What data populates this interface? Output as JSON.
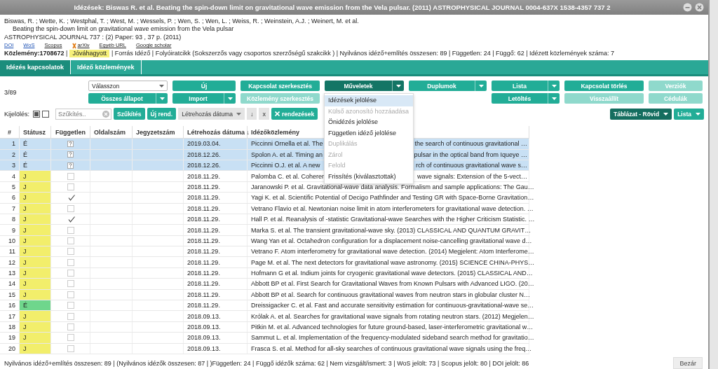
{
  "window": {
    "title": "Idézések: Biswas R. et al. Beating the spin-down limit on gravitational wave emission from the Vela pulsar. (2011) ASTROPHYSICAL JOURNAL 0004-637X 1538-4357 737 2"
  },
  "publication": {
    "authors": "Biswas, R. ; Wette, K. ; Westphal, T. ; West, M. ; Wessels, P. ; Wen, S. ; Wen, L. ; Weiss, R. ; Weinstein, A.J. ; Weinert, M. et al.",
    "title": "Beating the spin-down limit on gravitational wave emission from the Vela pulsar",
    "journal": "ASTROPHYSICAL JOURNAL 737 : (2) Paper: 93 , 37 p. (2011)",
    "links": [
      {
        "label": "DOI",
        "kind": "plain"
      },
      {
        "label": "WoS",
        "kind": "plain"
      },
      {
        "label": "Scopus",
        "kind": "plain"
      },
      {
        "label": "arXiv",
        "kind": "arxiv"
      },
      {
        "label": "Egyéb URL",
        "kind": "plain"
      },
      {
        "label": "Google scholar",
        "kind": "plain"
      }
    ],
    "id_text": "**Közlemény:1708672** |",
    "status_badge": "Jóváhagyott",
    "summary": "| Forrás Idéző | Folyóiratcikk (Sokszerzős vagy csoportos szerzőségű szakcikk ) | Nyilvános idéző+említés összesen: 89 | Független: 24 | Függő: 62 | Idézett közlemények száma: 7"
  },
  "tabs": [
    {
      "label": "Idézés kapcsolatok",
      "selected": true
    },
    {
      "label": "Idéző közlemények",
      "selected": false
    }
  ],
  "toolbar": {
    "count": "3/89",
    "row_1": [
      {
        "label": "Válasszon",
        "kind": "select",
        "disabled": false
      },
      {
        "label": "Új",
        "kind": "button",
        "disabled": false
      },
      {
        "label": "Kapcsolat szerkesztés",
        "kind": "button",
        "disabled": false
      },
      {
        "label": "Műveletek",
        "kind": "split",
        "disabled": false,
        "expanded": true
      },
      {
        "label": "Duplumok",
        "kind": "split",
        "disabled": false
      },
      {
        "label": "Lista",
        "kind": "split",
        "disabled": false
      },
      {
        "label": "Kapcsolat törlés",
        "kind": "button",
        "disabled": false
      },
      {
        "label": "Verziók",
        "kind": "button",
        "disabled": true
      }
    ],
    "row_2": [
      {
        "label": "Összes állapot",
        "kind": "split",
        "disabled": false
      },
      {
        "label": "Import",
        "kind": "split",
        "disabled": false
      },
      {
        "label": "Közlemény szerkesztés",
        "kind": "button",
        "disabled": true
      },
      {
        "label": "Letöltés",
        "kind": "split",
        "disabled": false
      },
      {
        "label": "Visszaállít",
        "kind": "button",
        "disabled": true
      },
      {
        "label": "Cédulák",
        "kind": "button",
        "disabled": true
      }
    ],
    "selection_label": "Kijelölés:",
    "select_all_checked": true,
    "select_none_checked": false,
    "filter_placeholder": "Szűkítés..",
    "filter_button": "Szűkítés",
    "new_order_button": "Új rend.",
    "sort_field": "Létrehozás dátuma",
    "sort_direction": "↓",
    "sort_clear": "x",
    "remove_sorts_button": "rendezések",
    "view_button": "Táblázat - Rövid",
    "list_button": "Lista"
  },
  "menu": [
    {
      "label": "Idézések jelölése",
      "selected": true,
      "disabled": false
    },
    {
      "label": "Külső azonosító hozzáadása",
      "selected": false,
      "disabled": true
    },
    {
      "label": "Önidézés jelölése",
      "selected": false,
      "disabled": false
    },
    {
      "label": "Független idéző jelölése",
      "selected": false,
      "disabled": false
    },
    {
      "label": "Duplikálás",
      "selected": false,
      "disabled": true
    },
    {
      "label": "Zárol",
      "selected": false,
      "disabled": true
    },
    {
      "label": "Felold",
      "selected": false,
      "disabled": true
    },
    {
      "label": "Frissítés (kiválasztottak)",
      "selected": false,
      "disabled": false
    }
  ],
  "table": {
    "columns": [
      "#",
      "Státusz",
      "Független",
      "Oldalszám",
      "Jegyzetszám",
      "Létrehozás dátuma ↓",
      "Idézőközlemény"
    ],
    "rows": [
      {
        "num": "1",
        "status": "É",
        "selected": true,
        "unknown": true,
        "date": "2019.03.04.",
        "citation": "Piccinni Ornella et al. The",
        "citation_tail": "the search of continuous gravitational …"
      },
      {
        "num": "2",
        "status": "É",
        "selected": true,
        "unknown": true,
        "date": "2018.12.26.",
        "citation": "Spolon A. et al. Timing an",
        "citation_tail": "pulsar in the optical band from Iqueye …"
      },
      {
        "num": "3",
        "status": "É",
        "selected": true,
        "unknown": true,
        "date": "2018.12.26.",
        "citation": "Piccinni O.J. et al. A new",
        "citation_tail": "rch of continuous gravitational wave s…"
      },
      {
        "num": "4",
        "status": "J",
        "color": "#f2ee6b",
        "selected": false,
        "unknown": false,
        "checked": false,
        "date": "2018.11.29.",
        "citation": "Palomba C. et al. Coheren",
        "citation_tail": "wave signals: Extension of the 5-vect…"
      },
      {
        "num": "5",
        "status": "J",
        "color": "#f2ee6b",
        "selected": false,
        "unknown": false,
        "checked": false,
        "date": "2018.11.29.",
        "citation": "Jaranowski P. et al. Gravitational-wave data analysis. Formalism and sample applications: The Gau…"
      },
      {
        "num": "6",
        "status": "J",
        "color": "#f2ee6b",
        "selected": false,
        "unknown": false,
        "checked": true,
        "date": "2018.11.29.",
        "citation": "Yagi K. et al. Scientific Potential of Decigo Pathfinder and Testing GR with Space-Borne Gravitation…"
      },
      {
        "num": "7",
        "status": "J",
        "color": "#f2ee6b",
        "selected": false,
        "unknown": false,
        "checked": false,
        "date": "2018.11.29.",
        "citation": "Vetrano Flavio et al. Newtonian noise limit in atom interferometers for gravitational wave detection. …"
      },
      {
        "num": "8",
        "status": "J",
        "color": "#f2ee6b",
        "selected": false,
        "unknown": false,
        "checked": true,
        "date": "2018.11.29.",
        "citation": "Hall P. et al. Reanalysis of -statistic Gravitational-wave Searches with the Higher Criticism Statistic. …"
      },
      {
        "num": "9",
        "status": "J",
        "color": "#f2ee6b",
        "selected": false,
        "unknown": false,
        "checked": false,
        "date": "2018.11.29.",
        "citation": "Marka S. et al. The transient gravitational-wave sky. (2013) CLASSICAL AND QUANTUM GRAVIT…"
      },
      {
        "num": "10",
        "status": "J",
        "color": "#f2ee6b",
        "selected": false,
        "unknown": false,
        "checked": false,
        "date": "2018.11.29.",
        "citation": "Wang Yan et al. Octahedron configuration for a displacement noise-cancelling gravitational wave d…"
      },
      {
        "num": "11",
        "status": "J",
        "color": "#f2ee6b",
        "selected": false,
        "unknown": false,
        "checked": false,
        "date": "2018.11.29.",
        "citation": "Vetrano F. Atom interferometry for gravitational wave detection. (2014) Megjelent: Atom Interferome…"
      },
      {
        "num": "12",
        "status": "J",
        "color": "#f2ee6b",
        "selected": false,
        "unknown": false,
        "checked": false,
        "date": "2018.11.29.",
        "citation": "Page M. et al. The next detectors for gravitational wave astronomy. (2015) SCIENCE CHINA-PHYS…"
      },
      {
        "num": "13",
        "status": "J",
        "color": "#f2ee6b",
        "selected": false,
        "unknown": false,
        "checked": false,
        "date": "2018.11.29.",
        "citation": "Hofmann G et al. Indium joints for cryogenic gravitational wave detectors. (2015) CLASSICAL AND…"
      },
      {
        "num": "14",
        "status": "J",
        "color": "#f2ee6b",
        "selected": false,
        "unknown": false,
        "checked": false,
        "date": "2018.11.29.",
        "citation": "Abbott BP et al. First Search for Gravitational Waves from Known Pulsars with Advanced LIGO. (20…"
      },
      {
        "num": "15",
        "status": "J",
        "color": "#f2ee6b",
        "selected": false,
        "unknown": false,
        "checked": false,
        "date": "2018.11.29.",
        "citation": "Abbott BP et al. Search for continuous gravitational waves from neutron stars in globular cluster N…"
      },
      {
        "num": "16",
        "status": "É",
        "color": "#6fd68c",
        "selected": false,
        "unknown": false,
        "checked": false,
        "date": "2018.11.29.",
        "citation": "Dreissigacker C. et al. Fast and accurate sensitivity estimation for continuous-gravitational-wave se…"
      },
      {
        "num": "17",
        "status": "J",
        "color": "#f2ee6b",
        "selected": false,
        "unknown": false,
        "checked": false,
        "date": "2018.09.13.",
        "citation": "Królak A. et al. Searches for gravitational wave signals from rotating neutron stars. (2012) Megjelen…"
      },
      {
        "num": "18",
        "status": "J",
        "color": "#f2ee6b",
        "selected": false,
        "unknown": false,
        "checked": false,
        "date": "2018.09.13.",
        "citation": "Pitkin M. et al. Advanced technologies for future ground-based, laser-interferometric gravitational w…"
      },
      {
        "num": "19",
        "status": "J",
        "color": "#f2ee6b",
        "selected": false,
        "unknown": false,
        "checked": false,
        "date": "2018.09.13.",
        "citation": "Sammut L. et al. Implementation of the frequency-modulated sideband search method for gravitatio…"
      },
      {
        "num": "20",
        "status": "J",
        "color": "#f2ee6b",
        "selected": false,
        "unknown": false,
        "checked": false,
        "date": "2018.09.13.",
        "citation": "Frasca S. et al. Method for all-sky searches of continuous gravitational wave signals using the freq…"
      }
    ]
  },
  "footer": {
    "stats": "Nyilvános idéző+említés összesen: 89 | (Nyilvános idézők összesen: 87 | )Független: 24 | Függő idézők száma: 62 | Nem vizsgált/ismert: 3 | WoS jelölt: 73 | Scopus jelölt: 80 | DOI jelölt: 86",
    "close_button": "Bezár"
  }
}
